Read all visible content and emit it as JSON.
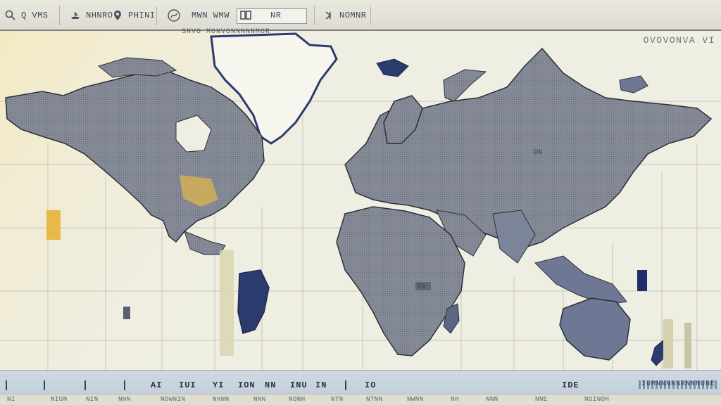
{
  "toolbar": {
    "items": [
      {
        "icon": "search-icon",
        "label": "Q VMS"
      },
      {
        "icon": "ship-icon",
        "label": "NHNRO"
      },
      {
        "icon": "pin-icon",
        "label": "PHINI"
      },
      {
        "icon": "route-icon",
        "label": "MWN WMW"
      },
      {
        "icon": "layers-icon",
        "label": "NR"
      },
      {
        "icon": "time-icon",
        "label": "NOMNR"
      }
    ]
  },
  "map": {
    "title": "SNVO MONVONNNNNMOR",
    "corner_label": "OVOVONVA VI",
    "land_color": "#8f939c",
    "ocean_color": "#efeee3",
    "accent_color": "#2c3b6e",
    "grid_color": "#c9c6b6",
    "labels": [
      "DN",
      "IN"
    ]
  },
  "timeline": {
    "labels": [
      "AI",
      "IUI",
      "YI",
      "ION",
      "NN",
      "INU",
      "IN",
      "IO",
      "IDE"
    ],
    "legend": "IUMNNNNNRNNNUNE"
  },
  "statusbar": {
    "items": [
      "NI",
      "NIUN",
      "NIN",
      "NHN",
      "NOWNIN",
      "NHNN",
      "NNN",
      "NONH",
      "NTN",
      "NTNN",
      "NWNN",
      "NH",
      "NNN",
      "NNE",
      "NOINOH"
    ]
  }
}
